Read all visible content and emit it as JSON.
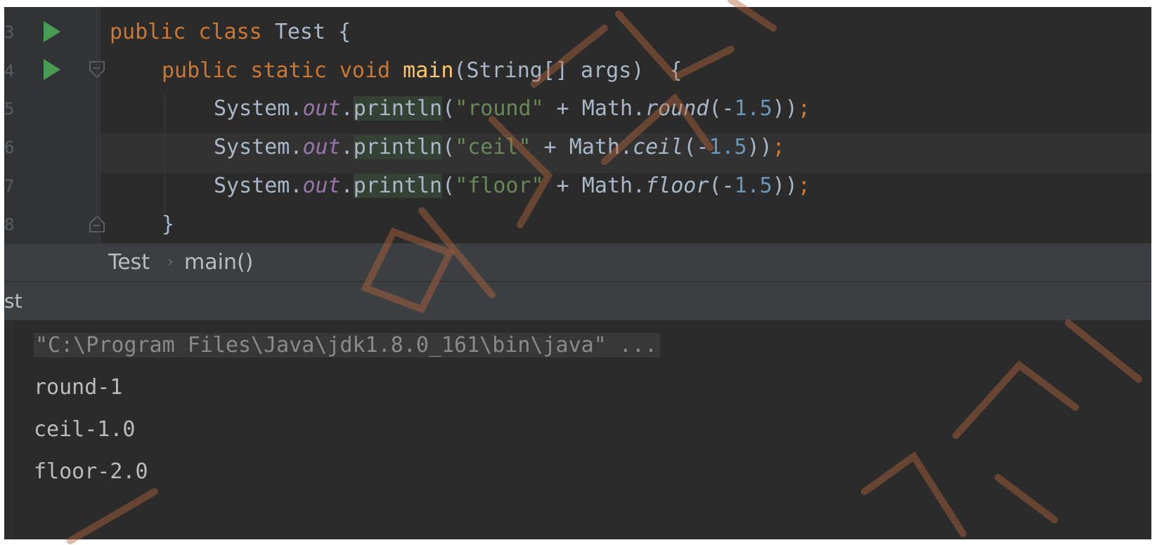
{
  "editor": {
    "line_numbers": [
      "3",
      "4",
      "5",
      "6",
      "7",
      "8"
    ],
    "lines": [
      {
        "tokens": [
          {
            "t": "public class ",
            "c": "kw"
          },
          {
            "t": "Test ",
            "c": ""
          },
          {
            "t": "{",
            "c": ""
          }
        ]
      },
      {
        "tokens": [
          {
            "t": "public static void ",
            "c": "kw"
          },
          {
            "t": "main",
            "c": "fn"
          },
          {
            "t": "(String[] args)  {",
            "c": ""
          }
        ]
      },
      {
        "tokens": [
          {
            "t": "System.",
            "c": ""
          },
          {
            "t": "out",
            "c": "fld"
          },
          {
            "t": ".",
            "c": ""
          },
          {
            "t": "println",
            "c": "hl"
          },
          {
            "t": "(",
            "c": ""
          },
          {
            "t": "\"round\"",
            "c": "str"
          },
          {
            "t": " + Math.",
            "c": ""
          },
          {
            "t": "round",
            "c": "it"
          },
          {
            "t": "(-",
            "c": ""
          },
          {
            "t": "1.5",
            "c": "num"
          },
          {
            "t": "))",
            "c": ""
          },
          {
            "t": ";",
            "c": "semi"
          }
        ]
      },
      {
        "tokens": [
          {
            "t": "System.",
            "c": ""
          },
          {
            "t": "out",
            "c": "fld"
          },
          {
            "t": ".",
            "c": ""
          },
          {
            "t": "println",
            "c": "hl"
          },
          {
            "t": "(",
            "c": ""
          },
          {
            "t": "\"ceil\"",
            "c": "str"
          },
          {
            "t": " + Math.",
            "c": ""
          },
          {
            "t": "ceil",
            "c": "it"
          },
          {
            "t": "(-",
            "c": ""
          },
          {
            "t": "1.5",
            "c": "num"
          },
          {
            "t": "))",
            "c": ""
          },
          {
            "t": ";",
            "c": "semi"
          }
        ]
      },
      {
        "tokens": [
          {
            "t": "System.",
            "c": ""
          },
          {
            "t": "out",
            "c": "fld"
          },
          {
            "t": ".",
            "c": ""
          },
          {
            "t": "println",
            "c": "hl"
          },
          {
            "t": "(",
            "c": ""
          },
          {
            "t": "\"floor\"",
            "c": "str"
          },
          {
            "t": " + Math.",
            "c": ""
          },
          {
            "t": "floor",
            "c": "it"
          },
          {
            "t": "(-",
            "c": ""
          },
          {
            "t": "1.5",
            "c": "num"
          },
          {
            "t": "))",
            "c": ""
          },
          {
            "t": ";",
            "c": "semi"
          }
        ]
      },
      {
        "tokens": [
          {
            "t": "}",
            "c": ""
          }
        ]
      }
    ],
    "gutter_icons": {
      "run": "run-gutter-icon",
      "fold": "fold-marker-icon"
    }
  },
  "breadcrumb": {
    "items": [
      "Test",
      "main()"
    ],
    "separator": "›"
  },
  "run_panel": {
    "tab_label": "st"
  },
  "console": {
    "command": "\"C:\\Program Files\\Java\\jdk1.8.0_161\\bin\\java\" ...",
    "output": [
      "round-1",
      "ceil-1.0",
      "floor-2.0"
    ]
  },
  "colors": {
    "editor_bg": "#2b2b2b",
    "gutter_bg": "#313335",
    "keyword": "#cc7832",
    "method_decl": "#ffc66d",
    "field": "#9876aa",
    "string": "#6a8759",
    "number": "#6897bb",
    "run_icon": "#499c54"
  }
}
